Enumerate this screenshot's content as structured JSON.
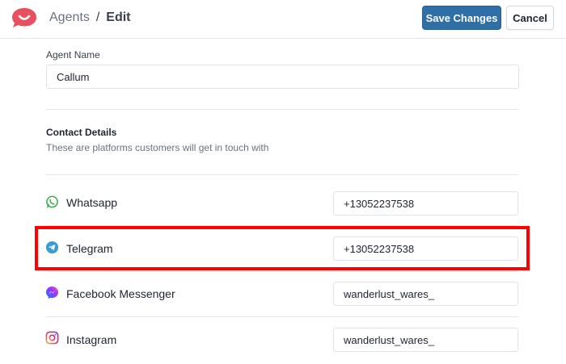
{
  "header": {
    "breadcrumb_root": "Agents",
    "breadcrumb_sep": "/",
    "breadcrumb_current": "Edit",
    "save_label": "Save Changes",
    "cancel_label": "Cancel"
  },
  "agent": {
    "name_label": "Agent Name",
    "name_value": "Callum"
  },
  "contact": {
    "title": "Contact Details",
    "subtitle": "These are platforms customers will get in touch with",
    "platforms": [
      {
        "name": "Whatsapp",
        "value": "+13052237538",
        "icon": "whatsapp-icon"
      },
      {
        "name": "Telegram",
        "value": "+13052237538",
        "icon": "telegram-icon"
      },
      {
        "name": "Facebook Messenger",
        "value": "wanderlust_wares_",
        "icon": "messenger-icon"
      },
      {
        "name": "Instagram",
        "value": "wanderlust_wares_",
        "icon": "instagram-icon"
      }
    ]
  },
  "colors": {
    "brand": "#e9505f",
    "primary_button": "#2f6fa8",
    "highlight": "#ff0000"
  }
}
